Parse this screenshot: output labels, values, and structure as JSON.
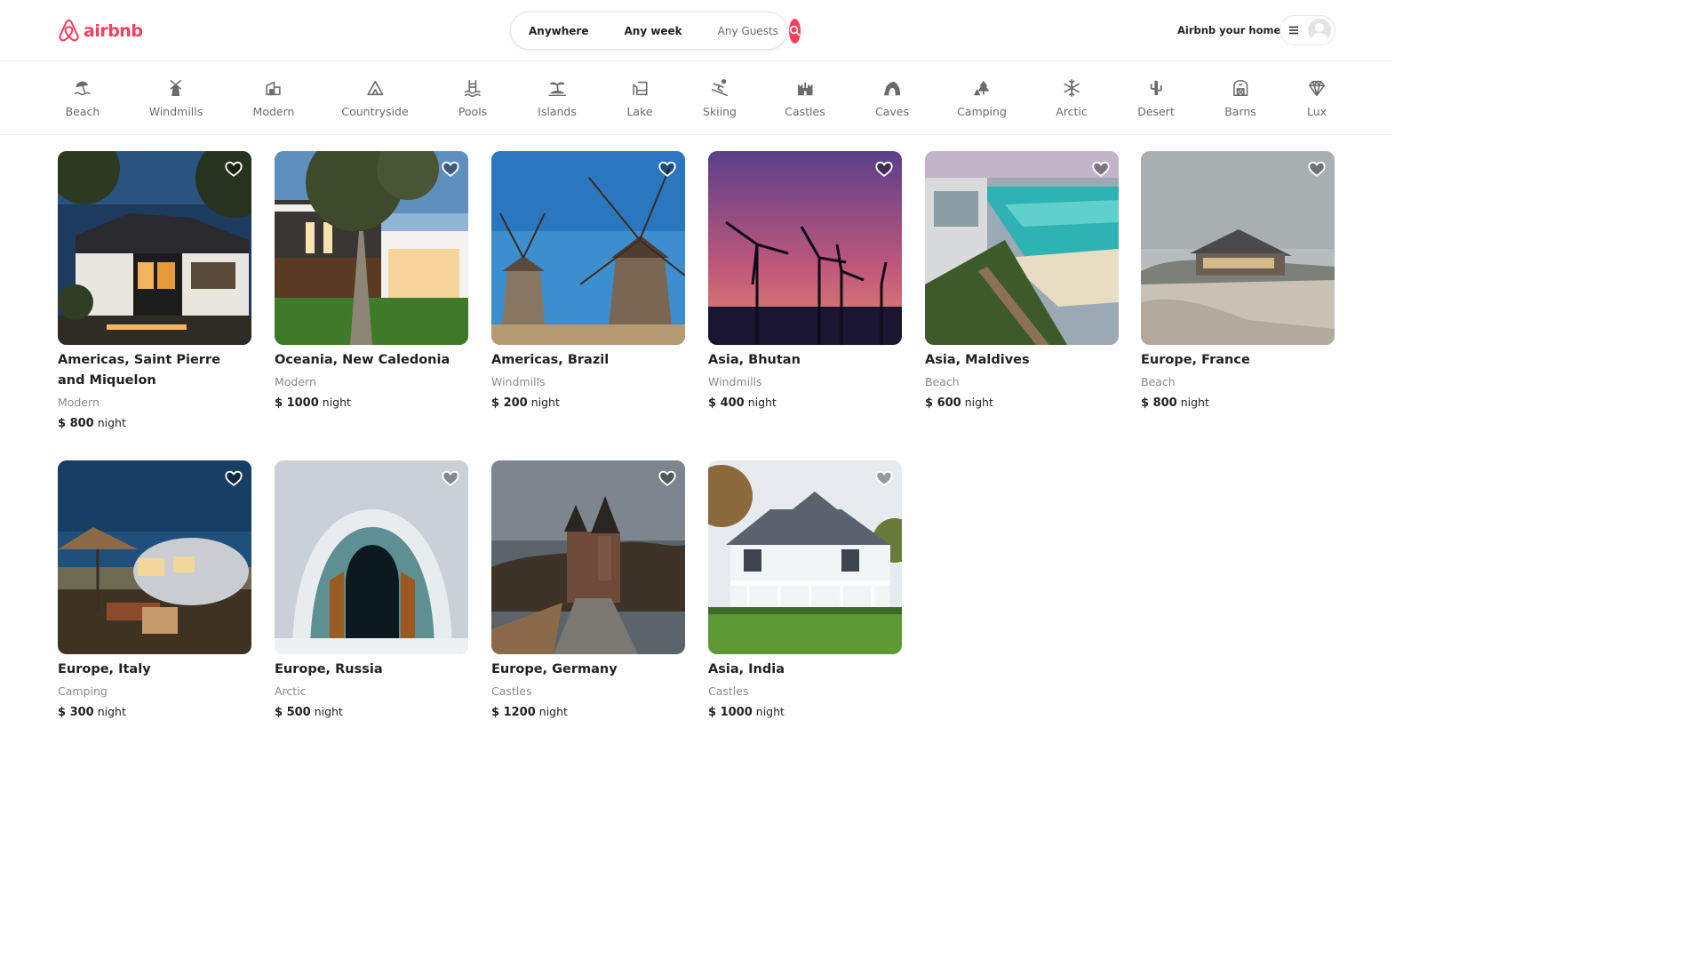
{
  "header": {
    "logo_text": "airbnb",
    "brand_color": "#f43f5e",
    "search": {
      "where": "Anywhere",
      "when": "Any week",
      "guests": "Any Guests"
    },
    "host_link": "Airbnb your home"
  },
  "categories": [
    {
      "label": "Beach",
      "icon": "beach-icon"
    },
    {
      "label": "Windmills",
      "icon": "windmill-icon"
    },
    {
      "label": "Modern",
      "icon": "modern-house-icon"
    },
    {
      "label": "Countryside",
      "icon": "mountain-icon"
    },
    {
      "label": "Pools",
      "icon": "pool-icon"
    },
    {
      "label": "Islands",
      "icon": "island-icon"
    },
    {
      "label": "Lake",
      "icon": "lake-icon"
    },
    {
      "label": "Skiing",
      "icon": "skiing-icon"
    },
    {
      "label": "Castles",
      "icon": "castle-icon"
    },
    {
      "label": "Caves",
      "icon": "cave-icon"
    },
    {
      "label": "Camping",
      "icon": "camping-icon"
    },
    {
      "label": "Arctic",
      "icon": "snowflake-icon"
    },
    {
      "label": "Desert",
      "icon": "cactus-icon"
    },
    {
      "label": "Barns",
      "icon": "barn-icon"
    },
    {
      "label": "Lux",
      "icon": "diamond-icon"
    }
  ],
  "listings": [
    {
      "location": "Americas, Saint Pierre and Miquelon",
      "category": "Modern",
      "price": "$ 800",
      "unit": "night"
    },
    {
      "location": "Oceania, New Caledonia",
      "category": "Modern",
      "price": "$ 1000",
      "unit": "night"
    },
    {
      "location": "Americas, Brazil",
      "category": "Windmills",
      "price": "$ 200",
      "unit": "night"
    },
    {
      "location": "Asia, Bhutan",
      "category": "Windmills",
      "price": "$ 400",
      "unit": "night"
    },
    {
      "location": "Asia, Maldives",
      "category": "Beach",
      "price": "$ 600",
      "unit": "night"
    },
    {
      "location": "Europe, France",
      "category": "Beach",
      "price": "$ 800",
      "unit": "night"
    },
    {
      "location": "Europe, Italy",
      "category": "Camping",
      "price": "$ 300",
      "unit": "night"
    },
    {
      "location": "Europe, Russia",
      "category": "Arctic",
      "price": "$ 500",
      "unit": "night"
    },
    {
      "location": "Europe, Germany",
      "category": "Castles",
      "price": "$ 1200",
      "unit": "night"
    },
    {
      "location": "Asia, India",
      "category": "Castles",
      "price": "$ 1000",
      "unit": "night"
    }
  ]
}
